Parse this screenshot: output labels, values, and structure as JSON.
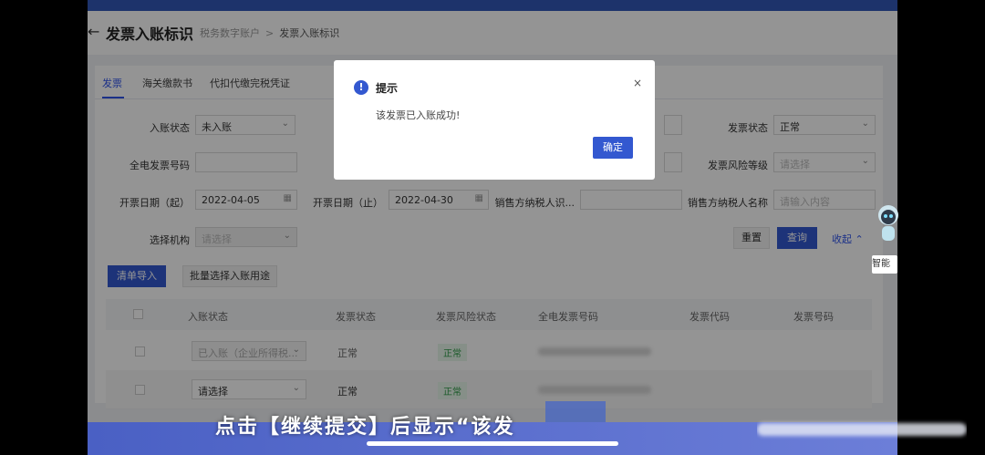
{
  "page": {
    "back_glyph": "←",
    "title": "发票入账标识",
    "breadcrumb": [
      "税务数字账户",
      "发票入账标识"
    ],
    "breadcrumb_sep": ">"
  },
  "tabs": [
    "发票",
    "海关缴款书",
    "代扣代缴完税凭证"
  ],
  "filters": {
    "entry_status_label": "入账状态",
    "entry_status_value": "未入账",
    "invoice_status_label": "发票状态",
    "invoice_status_value": "正常",
    "einvoice_no_label": "全电发票号码",
    "risk_level_label": "发票风险等级",
    "risk_level_placeholder": "请选择",
    "date_start_label": "开票日期（起）",
    "date_start_value": "2022-04-05",
    "date_end_label": "开票日期（止）",
    "date_end_value": "2022-04-30",
    "seller_taxid_label": "销售方纳税人识...",
    "seller_name_label": "销售方纳税人名称",
    "seller_name_placeholder": "请输入内容",
    "org_label": "选择机构",
    "org_placeholder": "请选择"
  },
  "actions": {
    "reset": "重置",
    "query": "查询",
    "collapse": "收起",
    "import_list": "清单导入",
    "batch_select": "批量选择入账用途"
  },
  "table": {
    "headers": [
      "入账状态",
      "发票状态",
      "发票风险状态",
      "全电发票号码",
      "发票代码",
      "发票号码"
    ],
    "rows": [
      {
        "entry": "已入账（企业所得税...",
        "status": "正常",
        "risk": "正常"
      },
      {
        "entry": "请选择",
        "status": "正常",
        "risk": "正常"
      }
    ]
  },
  "modal": {
    "icon": "!",
    "title": "提示",
    "message": "该发票已入账成功!",
    "ok": "确定",
    "close": "×"
  },
  "assistant": {
    "label": "智能"
  },
  "caption": "点击【继续提交】后显示“该发",
  "colors": {
    "primary": "#3358d0",
    "success": "#2e9b47",
    "topbar": "#3358b8"
  },
  "icons": [
    "back-arrow-icon",
    "chevron-down-icon",
    "calendar-icon",
    "chevron-up-icon",
    "info-icon",
    "close-icon",
    "assistant-mascot-icon"
  ]
}
